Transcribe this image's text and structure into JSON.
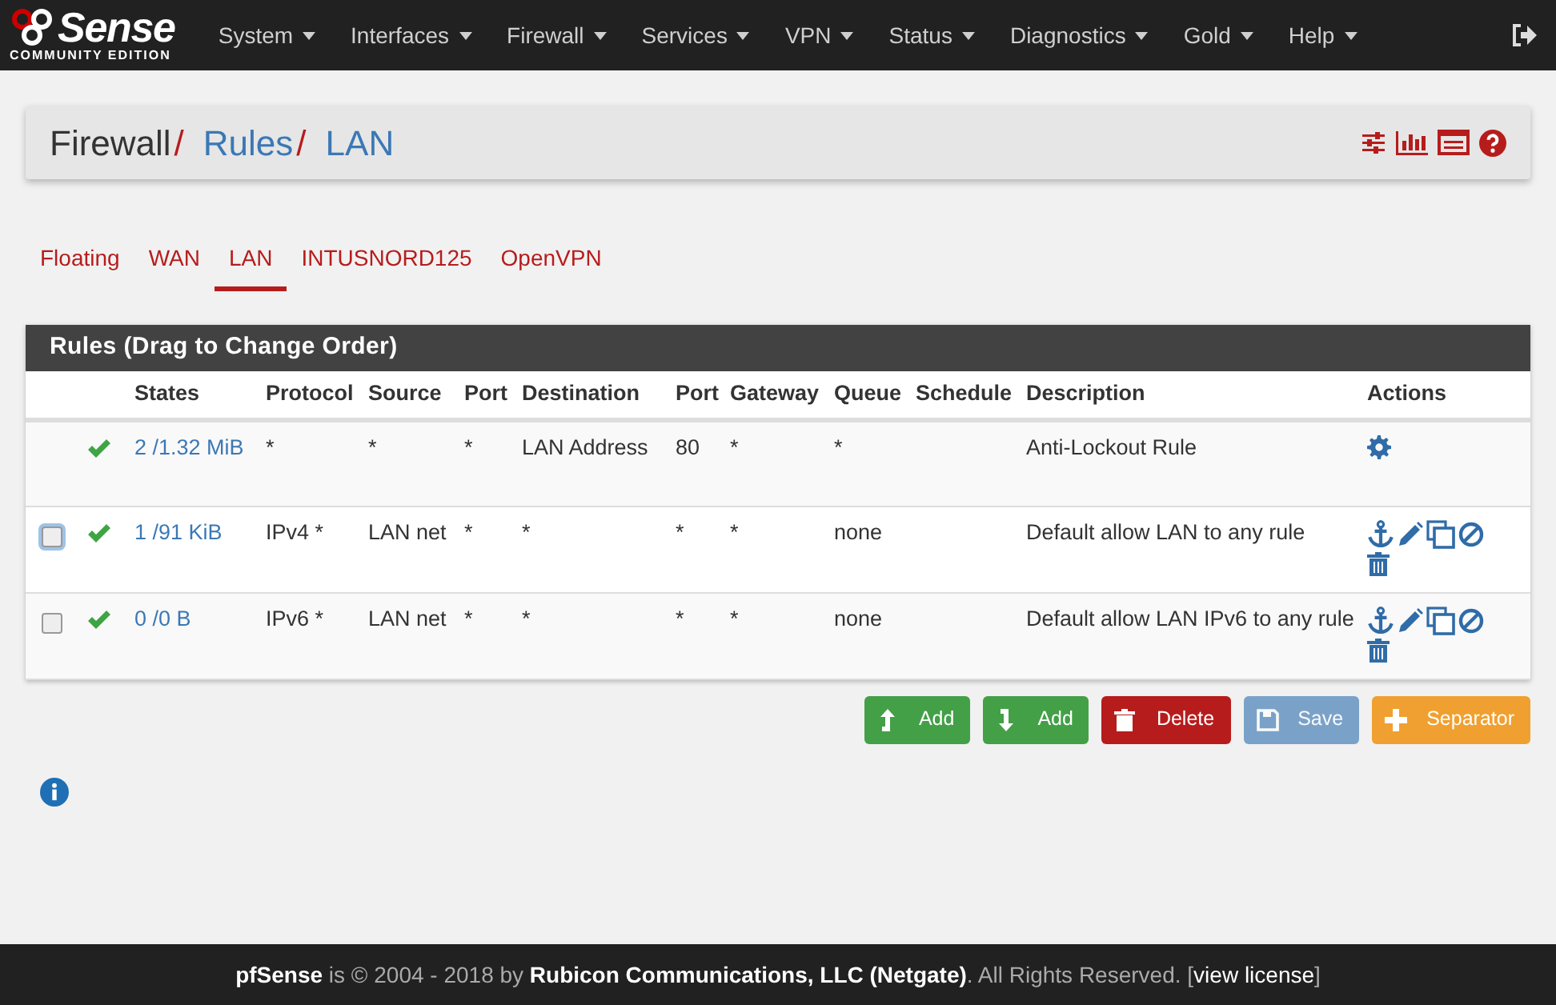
{
  "logo": {
    "word": "Sense",
    "tagline": "COMMUNITY EDITION"
  },
  "nav": [
    "System",
    "Interfaces",
    "Firewall",
    "Services",
    "VPN",
    "Status",
    "Diagnostics",
    "Gold",
    "Help"
  ],
  "breadcrumb": [
    "Firewall",
    "Rules",
    "LAN"
  ],
  "breadcrumb_separator": "/",
  "tabs": [
    {
      "label": "Floating",
      "selected": false
    },
    {
      "label": "WAN",
      "selected": false
    },
    {
      "label": "LAN",
      "selected": true
    },
    {
      "label": "INTUSNORD125",
      "selected": false
    },
    {
      "label": "OpenVPN",
      "selected": false
    }
  ],
  "panel_title": "Rules (Drag to Change Order)",
  "columns": [
    "States",
    "Protocol",
    "Source",
    "Port",
    "Destination",
    "Port",
    "Gateway",
    "Queue",
    "Schedule",
    "Description",
    "Actions"
  ],
  "rows": [
    {
      "kind": "locked",
      "enabled": true,
      "cells": [
        "2 /1.32 MiB",
        "*",
        "*",
        "*",
        "LAN Address",
        "80",
        "*",
        "*",
        "",
        "Anti-Lockout Rule"
      ]
    },
    {
      "kind": "rule",
      "checked": false,
      "focused": true,
      "enabled": true,
      "cells": [
        "1 /91 KiB",
        "IPv4 *",
        "LAN net",
        "*",
        "*",
        "*",
        "*",
        "none",
        "",
        "Default allow LAN to any rule"
      ]
    },
    {
      "kind": "rule",
      "checked": false,
      "focused": false,
      "enabled": true,
      "cells": [
        "0 /0 B",
        "IPv6 *",
        "LAN net",
        "*",
        "*",
        "*",
        "*",
        "none",
        "",
        "Default allow LAN IPv6 to any rule"
      ]
    }
  ],
  "buttons": [
    {
      "kind": "add-top",
      "label": "Add",
      "disabled": false
    },
    {
      "kind": "add-bottom",
      "label": "Add",
      "disabled": false
    },
    {
      "kind": "delete",
      "label": "Delete",
      "disabled": false
    },
    {
      "kind": "save",
      "label": "Save",
      "disabled": true
    },
    {
      "kind": "separator",
      "label": "Separator",
      "disabled": false
    }
  ],
  "footer": {
    "before": "**pfSense** is © 2004 - 2018 by **Rubicon Communications, LLC (Netgate)**. All Rights Reserved. [",
    "link": "view license",
    "after": "]"
  }
}
